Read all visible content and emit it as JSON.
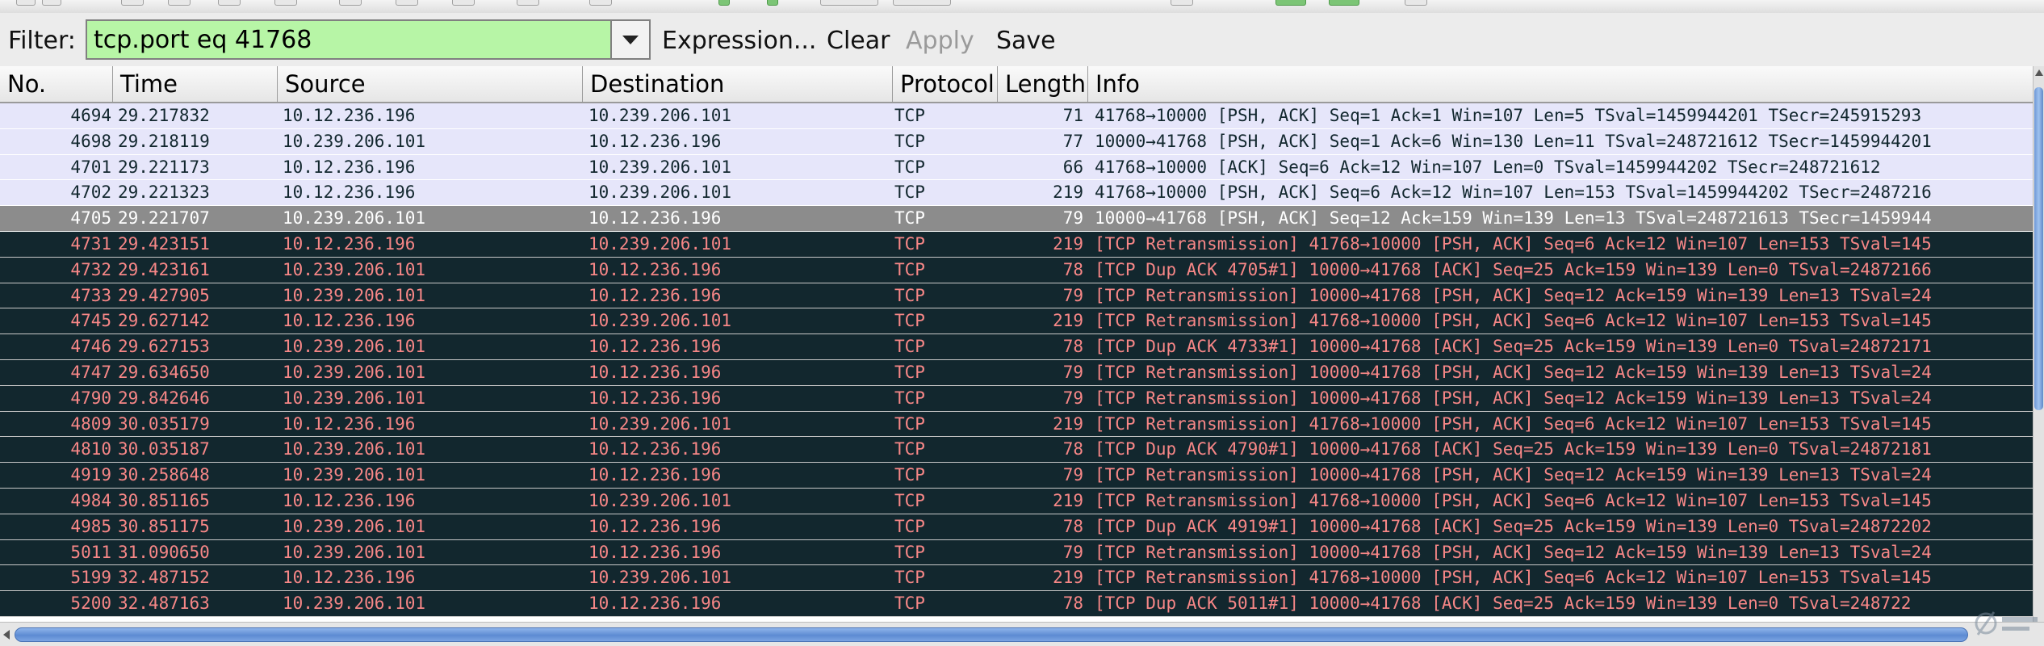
{
  "filter": {
    "label": "Filter:",
    "value": "tcp.port eq 41768",
    "expression_label": "Expression...",
    "clear_label": "Clear",
    "apply_label": "Apply",
    "save_label": "Save"
  },
  "columns": {
    "no": "No.",
    "time": "Time",
    "source": "Source",
    "destination": "Destination",
    "protocol": "Protocol",
    "length": "Length",
    "info": "Info"
  },
  "packets": [
    {
      "no": "4694",
      "time": "29.217832",
      "source": "10.12.236.196",
      "destination": "10.239.206.101",
      "protocol": "TCP",
      "length": "71",
      "info": "41768→10000 [PSH, ACK] Seq=1 Ack=1 Win=107 Len=5 TSval=1459944201 TSecr=245915293",
      "style": "normal"
    },
    {
      "no": "4698",
      "time": "29.218119",
      "source": "10.239.206.101",
      "destination": "10.12.236.196",
      "protocol": "TCP",
      "length": "77",
      "info": "10000→41768 [PSH, ACK] Seq=1 Ack=6 Win=130 Len=11 TSval=248721612 TSecr=1459944201",
      "style": "normal"
    },
    {
      "no": "4701",
      "time": "29.221173",
      "source": "10.12.236.196",
      "destination": "10.239.206.101",
      "protocol": "TCP",
      "length": "66",
      "info": "41768→10000 [ACK] Seq=6 Ack=12 Win=107 Len=0 TSval=1459944202 TSecr=248721612",
      "style": "normal"
    },
    {
      "no": "4702",
      "time": "29.221323",
      "source": "10.12.236.196",
      "destination": "10.239.206.101",
      "protocol": "TCP",
      "length": "219",
      "info": "41768→10000 [PSH, ACK] Seq=6 Ack=12 Win=107 Len=153 TSval=1459944202 TSecr=2487216",
      "style": "normal"
    },
    {
      "no": "4705",
      "time": "29.221707",
      "source": "10.239.206.101",
      "destination": "10.12.236.196",
      "protocol": "TCP",
      "length": "79",
      "info": "10000→41768 [PSH, ACK] Seq=12 Ack=159 Win=139 Len=13 TSval=248721613 TSecr=1459944",
      "style": "selected"
    },
    {
      "no": "4731",
      "time": "29.423151",
      "source": "10.12.236.196",
      "destination": "10.239.206.101",
      "protocol": "TCP",
      "length": "219",
      "info": "[TCP Retransmission] 41768→10000 [PSH, ACK] Seq=6 Ack=12 Win=107 Len=153 TSval=145",
      "style": "bad"
    },
    {
      "no": "4732",
      "time": "29.423161",
      "source": "10.239.206.101",
      "destination": "10.12.236.196",
      "protocol": "TCP",
      "length": "78",
      "info": "[TCP Dup ACK 4705#1] 10000→41768 [ACK] Seq=25 Ack=159 Win=139 Len=0 TSval=24872166",
      "style": "bad"
    },
    {
      "no": "4733",
      "time": "29.427905",
      "source": "10.239.206.101",
      "destination": "10.12.236.196",
      "protocol": "TCP",
      "length": "79",
      "info": "[TCP Retransmission] 10000→41768 [PSH, ACK] Seq=12 Ack=159 Win=139 Len=13 TSval=24",
      "style": "bad"
    },
    {
      "no": "4745",
      "time": "29.627142",
      "source": "10.12.236.196",
      "destination": "10.239.206.101",
      "protocol": "TCP",
      "length": "219",
      "info": "[TCP Retransmission] 41768→10000 [PSH, ACK] Seq=6 Ack=12 Win=107 Len=153 TSval=145",
      "style": "bad"
    },
    {
      "no": "4746",
      "time": "29.627153",
      "source": "10.239.206.101",
      "destination": "10.12.236.196",
      "protocol": "TCP",
      "length": "78",
      "info": "[TCP Dup ACK 4733#1] 10000→41768 [ACK] Seq=25 Ack=159 Win=139 Len=0 TSval=24872171",
      "style": "bad"
    },
    {
      "no": "4747",
      "time": "29.634650",
      "source": "10.239.206.101",
      "destination": "10.12.236.196",
      "protocol": "TCP",
      "length": "79",
      "info": "[TCP Retransmission] 10000→41768 [PSH, ACK] Seq=12 Ack=159 Win=139 Len=13 TSval=24",
      "style": "bad"
    },
    {
      "no": "4790",
      "time": "29.842646",
      "source": "10.239.206.101",
      "destination": "10.12.236.196",
      "protocol": "TCP",
      "length": "79",
      "info": "[TCP Retransmission] 10000→41768 [PSH, ACK] Seq=12 Ack=159 Win=139 Len=13 TSval=24",
      "style": "bad"
    },
    {
      "no": "4809",
      "time": "30.035179",
      "source": "10.12.236.196",
      "destination": "10.239.206.101",
      "protocol": "TCP",
      "length": "219",
      "info": "[TCP Retransmission] 41768→10000 [PSH, ACK] Seq=6 Ack=12 Win=107 Len=153 TSval=145",
      "style": "bad"
    },
    {
      "no": "4810",
      "time": "30.035187",
      "source": "10.239.206.101",
      "destination": "10.12.236.196",
      "protocol": "TCP",
      "length": "78",
      "info": "[TCP Dup ACK 4790#1] 10000→41768 [ACK] Seq=25 Ack=159 Win=139 Len=0 TSval=24872181",
      "style": "bad"
    },
    {
      "no": "4919",
      "time": "30.258648",
      "source": "10.239.206.101",
      "destination": "10.12.236.196",
      "protocol": "TCP",
      "length": "79",
      "info": "[TCP Retransmission] 10000→41768 [PSH, ACK] Seq=12 Ack=159 Win=139 Len=13 TSval=24",
      "style": "bad"
    },
    {
      "no": "4984",
      "time": "30.851165",
      "source": "10.12.236.196",
      "destination": "10.239.206.101",
      "protocol": "TCP",
      "length": "219",
      "info": "[TCP Retransmission] 41768→10000 [PSH, ACK] Seq=6 Ack=12 Win=107 Len=153 TSval=145",
      "style": "bad"
    },
    {
      "no": "4985",
      "time": "30.851175",
      "source": "10.239.206.101",
      "destination": "10.12.236.196",
      "protocol": "TCP",
      "length": "78",
      "info": "[TCP Dup ACK 4919#1] 10000→41768 [ACK] Seq=25 Ack=159 Win=139 Len=0 TSval=24872202",
      "style": "bad"
    },
    {
      "no": "5011",
      "time": "31.090650",
      "source": "10.239.206.101",
      "destination": "10.12.236.196",
      "protocol": "TCP",
      "length": "79",
      "info": "[TCP Retransmission] 10000→41768 [PSH, ACK] Seq=12 Ack=159 Win=139 Len=13 TSval=24",
      "style": "bad"
    },
    {
      "no": "5199",
      "time": "32.487152",
      "source": "10.12.236.196",
      "destination": "10.239.206.101",
      "protocol": "TCP",
      "length": "219",
      "info": "[TCP Retransmission] 41768→10000 [PSH, ACK] Seq=6 Ack=12 Win=107 Len=153 TSval=145",
      "style": "bad"
    },
    {
      "no": "5200",
      "time": "32.487163",
      "source": "10.239.206.101",
      "destination": "10.12.236.196",
      "protocol": "TCP",
      "length": "78",
      "info": "[TCP Dup ACK 5011#1] 10000→41768 [ACK] Seq=25 Ack=159 Win=139 Len=0 TSval=248722",
      "style": "bad"
    }
  ],
  "colors": {
    "normal_row_bg": "#e6e6fa",
    "normal_row_fg": "#12272e",
    "selected_row_bg": "#8c8c8c",
    "bad_row_bg": "#12272e",
    "bad_row_fg": "#f78787",
    "filter_valid_bg": "#b7f5a6",
    "scrollbar_thumb": "#6d97d6"
  },
  "icons": {
    "dropdown": "chevron-down-icon",
    "scroll_up": "arrow-up-icon",
    "scroll_left": "arrow-left-icon",
    "watermark": "watermark-logo"
  }
}
